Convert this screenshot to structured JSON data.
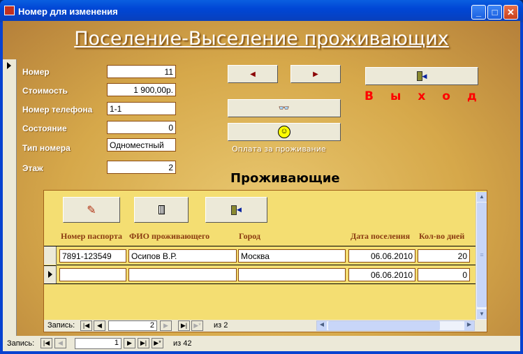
{
  "window": {
    "title": "Номер для изменения",
    "min": "_",
    "max": "□",
    "close": "✕"
  },
  "form_title": "Поселение-Выселение проживающих",
  "fields": [
    {
      "label": "Номер",
      "value": "11"
    },
    {
      "label": "Стоимость",
      "value": "1 900,00р."
    },
    {
      "label": "Номер телефона",
      "value": "1-1"
    },
    {
      "label": "Состояние",
      "value": "0"
    },
    {
      "label": "Тип номера",
      "value": "Одноместный"
    },
    {
      "label": "Этаж",
      "value": "2"
    }
  ],
  "buttons": {
    "prev": "◀",
    "next": "▶",
    "exit_text": "Выход",
    "payment_label": "Оплата за проживание"
  },
  "subform": {
    "title": "Проживающие",
    "columns": [
      "Номер паспорта",
      "ФИО проживающего",
      "Город",
      "Дата поселения",
      "Кол-во дней"
    ],
    "rows": [
      [
        "7891-123549",
        "Осипов В.Р.",
        "Москва",
        "06.06.2010",
        "20"
      ],
      [
        "",
        "",
        "",
        "06.06.2010",
        "0"
      ]
    ],
    "nav": {
      "label": "Запись:",
      "current": "2",
      "of": "из 2"
    }
  },
  "nav": {
    "label": "Запись:",
    "current": "1",
    "of": "из 42"
  }
}
